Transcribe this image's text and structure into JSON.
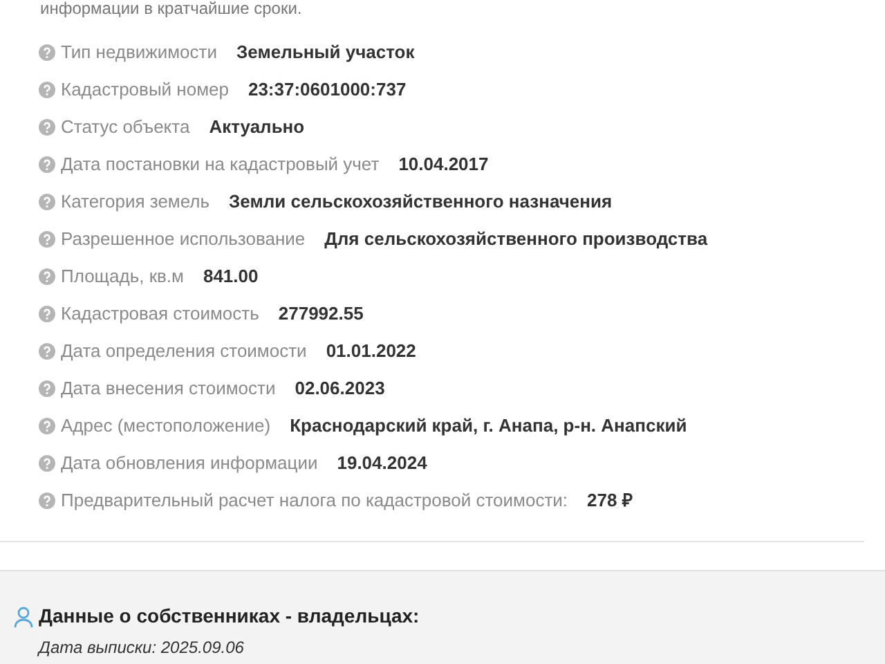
{
  "intro": "информации в кратчайшие сроки.",
  "fields": [
    {
      "label": "Тип недвижимости",
      "value": "Земельный участок"
    },
    {
      "label": "Кадастровый номер",
      "value": "23:37:0601000:737"
    },
    {
      "label": "Статус объекта",
      "value": "Актуально"
    },
    {
      "label": "Дата постановки на кадастровый учет",
      "value": "10.04.2017"
    },
    {
      "label": "Категория земель",
      "value": "Земли сельскохозяйственного назначения"
    },
    {
      "label": "Разрешенное использование",
      "value": "Для сельскохозяйственного производства"
    },
    {
      "label": "Площадь, кв.м",
      "value": "841.00"
    },
    {
      "label": "Кадастровая стоимость",
      "value": "277992.55"
    },
    {
      "label": "Дата определения стоимости",
      "value": "01.01.2022"
    },
    {
      "label": "Дата внесения стоимости",
      "value": "02.06.2023"
    },
    {
      "label": "Адрес (местоположение)",
      "value": "Краснодарский край, г. Анапа, р-н. Анапский"
    },
    {
      "label": "Дата обновления информации",
      "value": "19.04.2024"
    },
    {
      "label": "Предварительный расчет налога по кадастровой стоимости:",
      "value": "278 ₽"
    }
  ],
  "owners": {
    "title": "Данные о собственниках - владельцах:",
    "extract_date": "Дата выписки: 2025.09.06"
  }
}
